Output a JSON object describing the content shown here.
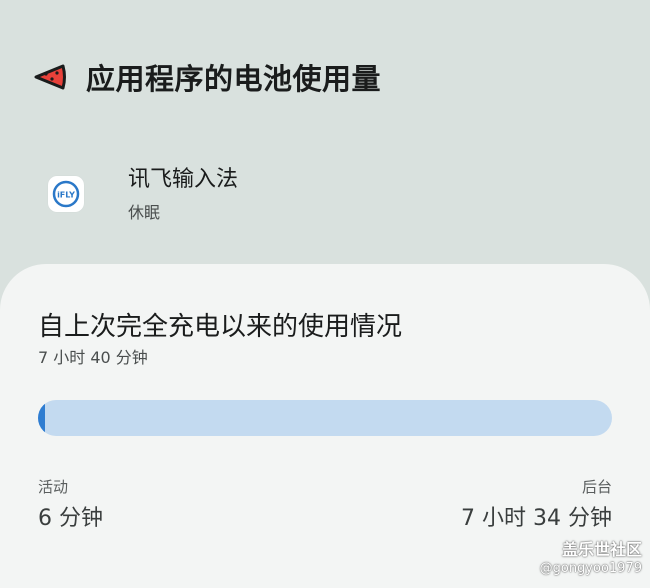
{
  "header": {
    "title": "应用程序的电池使用量",
    "back_icon": "back-arrow-icon"
  },
  "app": {
    "icon_text": "iFLY",
    "name": "讯飞输入法",
    "status": "休眠"
  },
  "usage_card": {
    "title": "自上次完全充电以来的使用情况",
    "total": "7 小时 40 分钟",
    "active_fraction": 0.013,
    "active_label": "活动",
    "active_value": "6 分钟",
    "background_label": "后台",
    "background_value": "7 小时 34 分钟"
  },
  "watermark": {
    "site": "盖乐世社区",
    "user": "@gongyoo1979"
  },
  "colors": {
    "background": "#d9e1de",
    "card": "#f3f5f4",
    "bar_track": "#c3daf0",
    "bar_fill": "#2f7dd1",
    "back_icon_red": "#e8413a"
  }
}
